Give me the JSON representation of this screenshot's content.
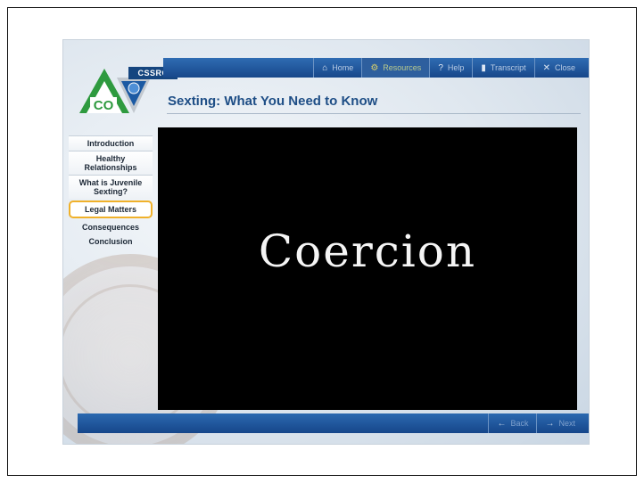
{
  "window": {
    "title": "Sexting: What You Need to Know"
  },
  "logo": {
    "badge": "CSSRC",
    "state": "CO"
  },
  "topnav": [
    {
      "label": "Home",
      "icon": "home-icon",
      "glyph": "⌂"
    },
    {
      "label": "Resources",
      "icon": "gear-icon",
      "glyph": "⚙"
    },
    {
      "label": "Help",
      "icon": "help-icon",
      "glyph": "?"
    },
    {
      "label": "Transcript",
      "icon": "document-icon",
      "glyph": "▮"
    },
    {
      "label": "Close",
      "icon": "close-icon",
      "glyph": "✕"
    }
  ],
  "sidebar": {
    "items": [
      {
        "label": "Introduction"
      },
      {
        "label": "Healthy Relationships"
      },
      {
        "label": "What is Juvenile Sexting?"
      },
      {
        "label": "Legal Matters"
      },
      {
        "label": "Consequences"
      },
      {
        "label": "Conclusion"
      }
    ]
  },
  "video": {
    "caption": "Coercion"
  },
  "bottomnav": [
    {
      "label": "Back",
      "icon": "arrow-left-icon",
      "glyph": "←"
    },
    {
      "label": "Next",
      "icon": "arrow-right-icon",
      "glyph": "→"
    }
  ],
  "colors": {
    "accent": "#1e4e86",
    "highlight": "#f0b12a",
    "logo_green": "#2e9a3f"
  }
}
